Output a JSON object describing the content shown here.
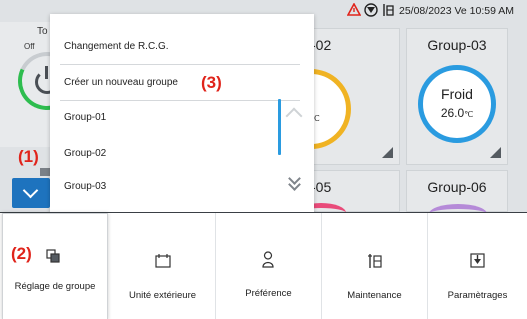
{
  "status_bar": {
    "datetime": "25/08/2023 Ve 10:59 AM",
    "icons": [
      "warning-icon",
      "filter-icon",
      "maintenance-icon"
    ]
  },
  "left_panel": {
    "title_partial": "To",
    "power_state": "Off"
  },
  "groups": [
    {
      "title_partial": "-02",
      "mode_partial": "o",
      "temp_partial": "5",
      "temp_unit": "℃",
      "ring_color": "#f0b323"
    },
    {
      "title": "Group-03",
      "mode": "Froid",
      "temp": "26.0",
      "temp_unit": "℃",
      "ring_color": "#2a9be0"
    },
    {
      "title_partial": "-05",
      "ring_color": "#e94b7a"
    },
    {
      "title": "Group-06",
      "ring_color": "#b58ad8"
    }
  ],
  "menu": {
    "items": [
      "Changement de R.C.G.",
      "Créer un nouveau groupe",
      "Group-01",
      "Group-02",
      "Group-03"
    ]
  },
  "callouts": {
    "c1": "(1)",
    "c2": "(2)",
    "c3": "(3)"
  },
  "bottom_nav": [
    {
      "label": "Réglage de groupe",
      "icon": "group-settings-icon",
      "active": true
    },
    {
      "label": "Unité extérieure",
      "icon": "outdoor-unit-icon",
      "active": false
    },
    {
      "label": "Préférence",
      "icon": "preference-icon",
      "active": false
    },
    {
      "label": "Maintenance",
      "icon": "maintenance-icon",
      "active": false
    },
    {
      "label": "Paramètrages",
      "icon": "settings-download-icon",
      "active": false
    }
  ],
  "colors": {
    "accent_blue": "#1e73be",
    "callout_red": "#e0241b",
    "power_green": "#2ebd4f"
  }
}
